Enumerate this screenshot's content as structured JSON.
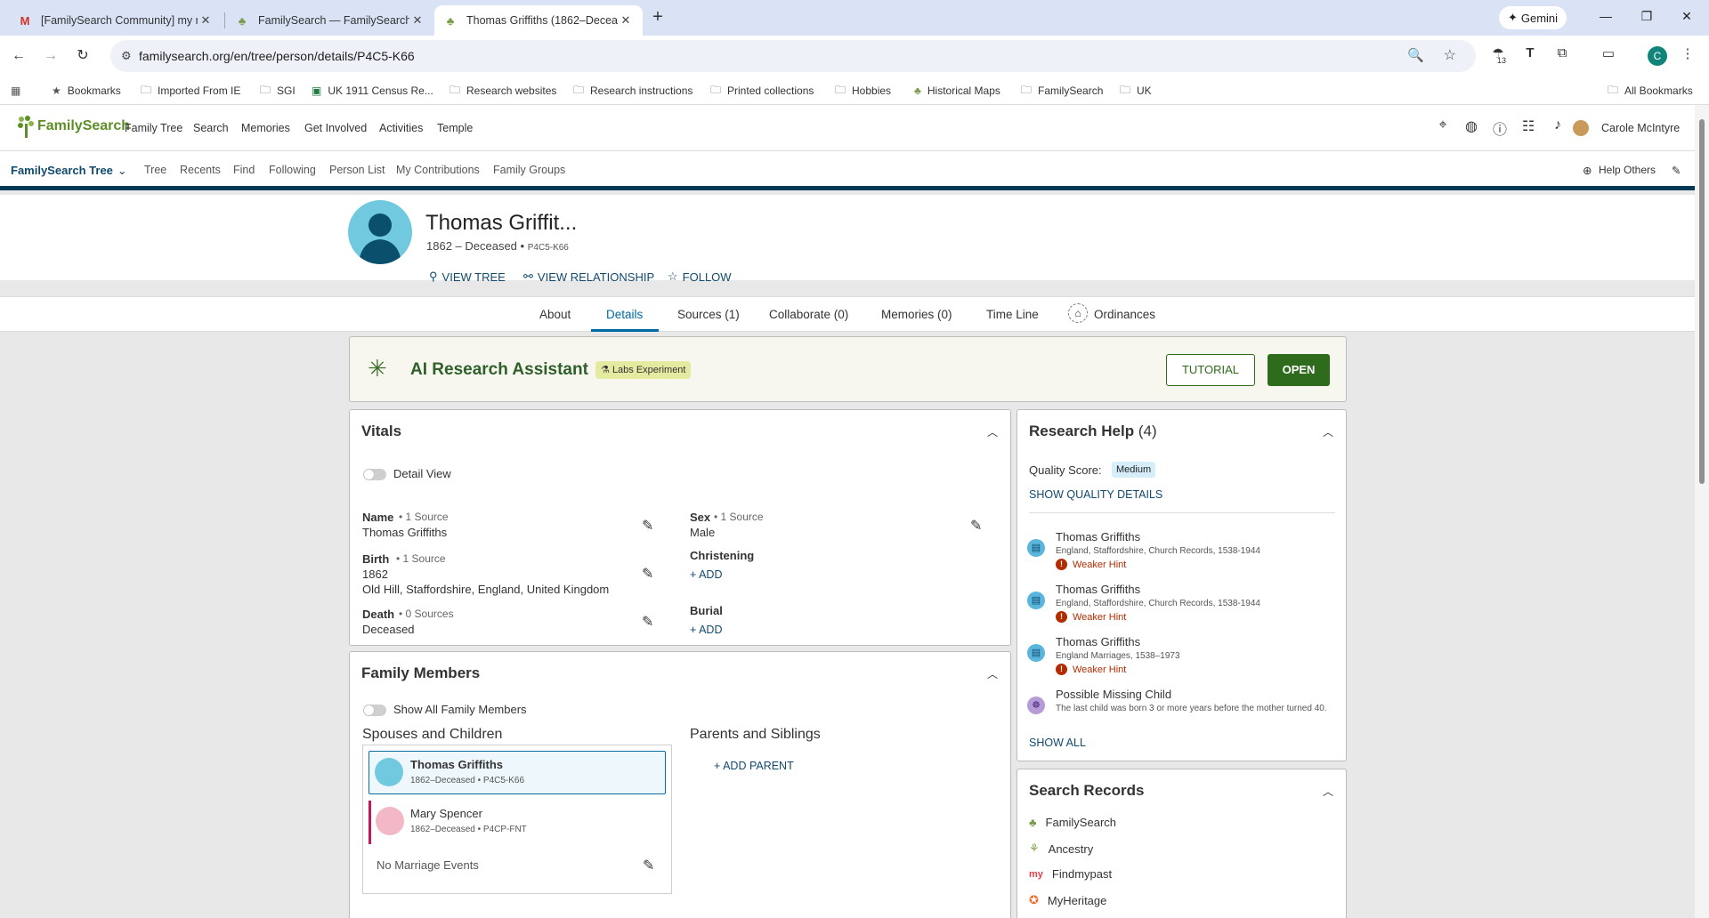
{
  "browser": {
    "tabs": [
      {
        "title": "[FamilySearch Community] my r",
        "icon": "gmail-icon"
      },
      {
        "title": "FamilySearch — FamilySearch C",
        "icon": "familysearch-icon"
      },
      {
        "title": "Thomas Griffiths (1862–Decease",
        "icon": "familysearch-icon"
      }
    ],
    "gemini_label": "Gemini",
    "url": "familysearch.org/en/tree/person/details/P4C5-K66",
    "extension_badge": "13",
    "profile_initial": "C",
    "bookmarks": [
      "Bookmarks",
      "Imported From IE",
      "SGI",
      "UK 1911 Census Re...",
      "Research websites",
      "Research instructions",
      "Printed collections",
      "Hobbies",
      "Historical Maps",
      "FamilySearch",
      "UK"
    ],
    "all_bookmarks": "All Bookmarks"
  },
  "header": {
    "logo": "FamilySearch",
    "nav": [
      "Family Tree",
      "Search",
      "Memories",
      "Get Involved",
      "Activities",
      "Temple"
    ],
    "user_name": "Carole McIntyre"
  },
  "subnav": {
    "title": "FamilySearch Tree",
    "items": [
      "Tree",
      "Recents",
      "Find",
      "Following",
      "Person List",
      "My Contributions",
      "Family Groups"
    ],
    "help_others": "Help Others"
  },
  "person": {
    "name": "Thomas Griffit...",
    "lifespan": "1862 – Deceased",
    "bullet": "•",
    "pid": "P4C5-K66",
    "actions": [
      "VIEW TREE",
      "VIEW RELATIONSHIP",
      "FOLLOW"
    ]
  },
  "tabs": [
    "About",
    "Details",
    "Sources (1)",
    "Collaborate (0)",
    "Memories (0)",
    "Time Line",
    "Ordinances"
  ],
  "ai": {
    "title": "AI Research Assistant",
    "badge": "Labs Experiment",
    "tutorial": "TUTORIAL",
    "open": "OPEN"
  },
  "vitals": {
    "title": "Vitals",
    "detail_view": "Detail View",
    "name_label": "Name",
    "name_sources": "• 1 Source",
    "name_value": "Thomas Griffiths",
    "birth_label": "Birth",
    "birth_sources": "• 1 Source",
    "birth_date": "1862",
    "birth_place": "Old Hill, Staffordshire, England, United Kingdom",
    "death_label": "Death",
    "death_sources": "• 0 Sources",
    "death_value": "Deceased",
    "sex_label": "Sex",
    "sex_sources": "• 1 Source",
    "sex_value": "Male",
    "christening_label": "Christening",
    "burial_label": "Burial",
    "add": "+ ADD"
  },
  "family": {
    "title": "Family Members",
    "show_all": "Show All Family Members",
    "spouses_title": "Spouses and Children",
    "parents_title": "Parents and Siblings",
    "add_parent": "+ ADD PARENT",
    "husband_name": "Thomas Griffiths",
    "husband_meta": "1862–Deceased • P4C5-K66",
    "wife_name": "Mary Spencer",
    "wife_meta": "1862–Deceased • P4CP-FNT",
    "no_marriage": "No Marriage Events"
  },
  "research_help": {
    "title": "Research Help",
    "count": "(4)",
    "quality_label": "Quality Score:",
    "quality_value": "Medium",
    "show_quality": "SHOW QUALITY DETAILS",
    "hints": [
      {
        "name": "Thomas Griffiths",
        "collection": "England, Staffordshire, Church Records, 1538-1944",
        "strength": "Weaker Hint"
      },
      {
        "name": "Thomas Griffiths",
        "collection": "England, Staffordshire, Church Records, 1538-1944",
        "strength": "Weaker Hint"
      },
      {
        "name": "Thomas Griffiths",
        "collection": "England Marriages, 1538–1973",
        "strength": "Weaker Hint"
      }
    ],
    "missing_title": "Possible Missing Child",
    "missing_text": "The last child was born 3 or more years before the mother turned 40.",
    "show_all": "SHOW ALL"
  },
  "search_records": {
    "title": "Search Records",
    "sites": [
      "FamilySearch",
      "Ancestry",
      "Findmypast",
      "MyHeritage"
    ]
  },
  "colors": {
    "brand_green": "#5e8e27",
    "link_blue": "#114a6e",
    "dark_navy": "#003a57",
    "open_button": "#2e6b1d",
    "weak_hint": "#b22c00"
  }
}
